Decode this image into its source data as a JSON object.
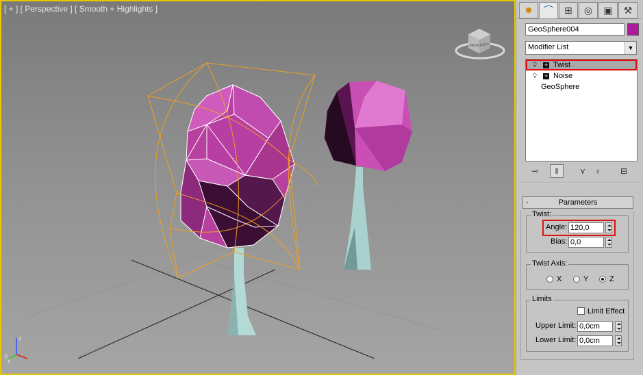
{
  "viewport": {
    "label": "[ + ] [ Perspective ] [ Smooth + Highlights ]",
    "axis": {
      "x": "x",
      "y": "y",
      "z": "z"
    },
    "viewcube": {
      "front": "FRONT",
      "left": "LEFT"
    }
  },
  "command_panel": {
    "tabs": [
      {
        "icon": "create-icon",
        "glyph": "✹"
      },
      {
        "icon": "modify-icon",
        "glyph": "⌒"
      },
      {
        "icon": "hierarchy-icon",
        "glyph": "⊞"
      },
      {
        "icon": "motion-icon",
        "glyph": "◎"
      },
      {
        "icon": "display-icon",
        "glyph": "▣"
      },
      {
        "icon": "utilities-icon",
        "glyph": "⚒"
      }
    ],
    "object_name": "GeoSphere004",
    "object_color": "#b01a9e",
    "modifier_list": "Modifier List",
    "stack": [
      {
        "label": "Twist",
        "selected": true
      },
      {
        "label": "Noise",
        "selected": false
      },
      {
        "label": "GeoSphere",
        "selected": false
      }
    ],
    "parameters": {
      "rollout_title": "Parameters",
      "collapse": "-",
      "twist_group": "Twist:",
      "angle_label": "Angle:",
      "angle_value": "120,0",
      "bias_label": "Bias:",
      "bias_value": "0,0",
      "axis_group": "Twist Axis:",
      "axis_x": "X",
      "axis_y": "Y",
      "axis_z": "Z",
      "selected_axis": "Z",
      "limits_group": "Limits",
      "limit_effect": "Limit Effect",
      "upper_label": "Upper Limit:",
      "upper_value": "0,0cm",
      "lower_label": "Lower Limit:",
      "lower_value": "0,0cm"
    }
  },
  "colors": {
    "viewport_border": "#e8c800",
    "highlight": "#e01010",
    "gizmo": "#f0a020",
    "geosphere": "#b0389e",
    "trunk": "#a9d2cf"
  }
}
